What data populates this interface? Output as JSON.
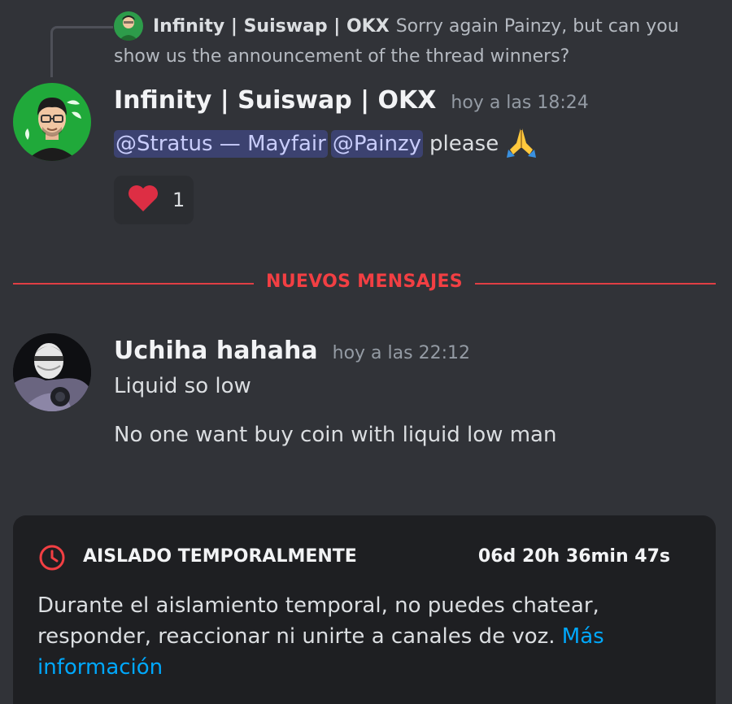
{
  "reply_preview": {
    "author": "Infinity | Suiswap | OKX",
    "text": "Sorry again Painzy, but can you show us the announcement of the thread winners?"
  },
  "message_1": {
    "author": "Infinity | Suiswap | OKX",
    "timestamp": "hoy a las 18:24",
    "mentions": [
      "@Stratus — Mayfair",
      "@Painzy"
    ],
    "text": "please",
    "emoji": "folded-hands-icon",
    "reaction": {
      "emoji": "heart-icon",
      "count": "1"
    }
  },
  "divider": {
    "label": "NUEVOS MENSAJES",
    "color": "#f23f43"
  },
  "message_2": {
    "author": "Uchiha hahaha",
    "timestamp": "hoy a las 22:12",
    "lines": [
      "Liquid so low",
      "No one want buy coin with liquid low man"
    ]
  },
  "timeout_notice": {
    "title": "AISLADO TEMPORALMENTE",
    "remaining": "06d 20h 36min 47s",
    "body": "Durante el aislamiento temporal, no puedes chatear, responder, reaccionar ni unirte a canales de voz.",
    "link": "Más información",
    "icon": "clock-icon"
  },
  "colors": {
    "background": "#313338",
    "mention_bg": "#3c4270",
    "link": "#00a8fc",
    "alert": "#f23f43"
  }
}
